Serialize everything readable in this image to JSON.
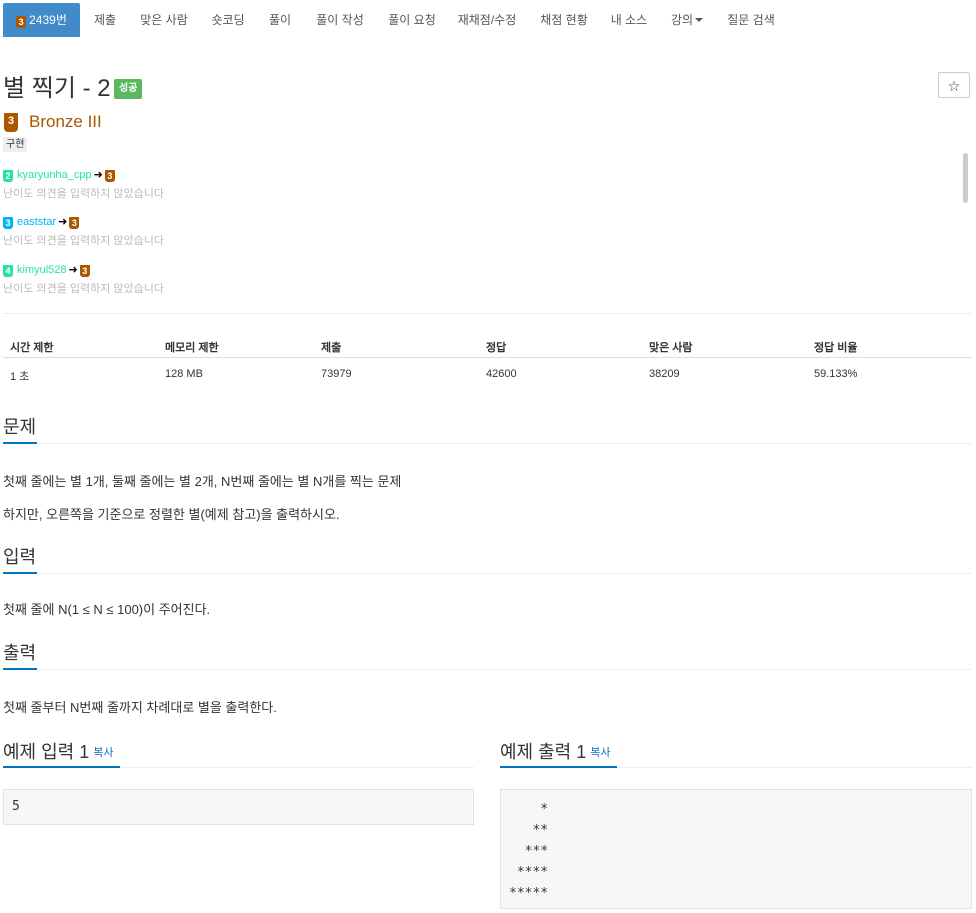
{
  "nav": {
    "problem_tier_num": "3",
    "problem_id": "2439번",
    "tabs": [
      "제출",
      "맞은 사람",
      "숏코딩",
      "풀이",
      "풀이 작성",
      "풀이 요청",
      "재채점/수정",
      "채점 현황",
      "내 소스",
      "강의",
      "질문 검색"
    ]
  },
  "problem": {
    "title": "별 찍기 - 2",
    "result_badge": "성공",
    "star_icon": "☆",
    "tier_num": "3",
    "tier_name": "Bronze III",
    "tag": "구현"
  },
  "opinions": [
    {
      "from_level": "2",
      "from_color": "#27e2a4",
      "user": "kyaryunha_cpp",
      "to_level": "3",
      "note": "난이도 의견을 입력하지 않았습니다"
    },
    {
      "from_level": "3",
      "from_color": "#00b4fc",
      "user": "eaststar",
      "to_level": "3",
      "note": "난이도 의견을 입력하지 않았습니다"
    },
    {
      "from_level": "4",
      "from_color": "#27e2a4",
      "user": "kimyul528",
      "to_level": "3",
      "note": "난이도 의견을 입력하지 않았습니다"
    }
  ],
  "stats": {
    "headers": [
      "시간 제한",
      "메모리 제한",
      "제출",
      "정답",
      "맞은 사람",
      "정답 비율"
    ],
    "values": [
      "1 초",
      "128 MB",
      "73979",
      "42600",
      "38209",
      "59.133%"
    ]
  },
  "sections": {
    "problem_title": "문제",
    "problem_lines": [
      "첫째 줄에는 별 1개, 둘째 줄에는 별 2개, N번째 줄에는 별 N개를 찍는 문제",
      "하지만, 오른쪽을 기준으로 정렬한 별(예제 참고)을 출력하시오."
    ],
    "input_title": "입력",
    "input_text": "첫째 줄에 N(1 ≤ N ≤ 100)이 주어진다.",
    "output_title": "출력",
    "output_text": "첫째 줄부터 N번째 줄까지 차례대로 별을 출력한다."
  },
  "samples": {
    "input_title": "예제 입력 1",
    "output_title": "예제 출력 1",
    "copy_label": "복사",
    "input_text": "5",
    "output_lines": [
      "    *",
      "   **",
      "  ***",
      " ****",
      "*****"
    ]
  },
  "colors": {
    "bronze": "#ad5600",
    "nav_active": "#428bca",
    "success": "#5cb85c",
    "link": "#0076c0"
  }
}
